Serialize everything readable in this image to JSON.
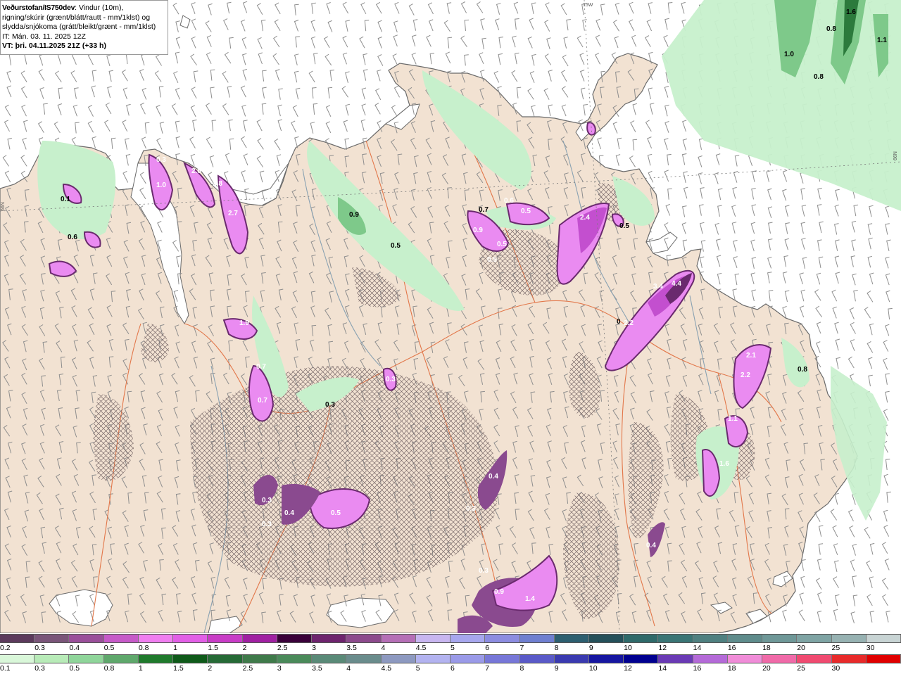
{
  "header": {
    "brand": "Veðurstofan/IS750dev",
    "desc1": ": Vindur (10m),",
    "desc2": "rigning/skúrir (grænt/blátt/rautt - mm/1klst) og",
    "desc3": "slydda/snjókoma (grátt/bleikt/grænt - mm/1klst)",
    "it": "IT: Mán. 03. 11. 2025 12Z",
    "vt": "VT: þri. 04.11.2025 21Z (+33 h)"
  },
  "grid_labels": {
    "top": "15W",
    "left": "66N",
    "right": "66N"
  },
  "colors": {
    "land": "#f2e2d2",
    "sea": "#ffffff",
    "roads": "#e2774a",
    "rivers": "#8aa2b2",
    "wind_barb": "#8e8e8e",
    "snow_dark": "#6a2a6e",
    "snow_mid": "#c34fcf",
    "snow_light": "#ea8bf1",
    "rain_light": "#c7f0cc",
    "rain_mid": "#7ec98a",
    "rain_dark": "#2c7a3c"
  },
  "precip_labels": [
    {
      "t": "0.3",
      "c": "white"
    },
    {
      "t": "1.0",
      "c": "white"
    },
    {
      "t": "2.8",
      "c": "white"
    },
    {
      "t": "2.8",
      "c": "white"
    },
    {
      "t": "2.7",
      "c": "white"
    },
    {
      "t": "1.9",
      "c": "white"
    },
    {
      "t": "0.7",
      "c": "white"
    },
    {
      "t": "0.7",
      "c": "white"
    },
    {
      "t": "0.3",
      "c": "white"
    },
    {
      "t": "0.4",
      "c": "white"
    },
    {
      "t": "0.5",
      "c": "white"
    },
    {
      "t": "0.3",
      "c": "white"
    },
    {
      "t": "0.4",
      "c": "white"
    },
    {
      "t": "0.3",
      "c": "white"
    },
    {
      "t": "0.3",
      "c": "white"
    },
    {
      "t": "0.9",
      "c": "white"
    },
    {
      "t": "1.4",
      "c": "white"
    },
    {
      "t": "0.3",
      "c": "white"
    },
    {
      "t": "0.9",
      "c": "white"
    },
    {
      "t": "0.5",
      "c": "white"
    },
    {
      "t": "0.5",
      "c": "white"
    },
    {
      "t": "2.4",
      "c": "white"
    },
    {
      "t": "0.5",
      "c": "white"
    },
    {
      "t": "0.6",
      "c": "white"
    },
    {
      "t": "3.4",
      "c": "white"
    },
    {
      "t": "4.4",
      "c": "white"
    },
    {
      "t": "2.2",
      "c": "white"
    },
    {
      "t": "2.1",
      "c": "white"
    },
    {
      "t": "2.2",
      "c": "white"
    },
    {
      "t": "1.1",
      "c": "white"
    },
    {
      "t": "1.6",
      "c": "white"
    },
    {
      "t": "0.4",
      "c": "white"
    },
    {
      "t": "0.1",
      "c": "black"
    },
    {
      "t": "0.6",
      "c": "black"
    },
    {
      "t": "0.9",
      "c": "black"
    },
    {
      "t": "0.5",
      "c": "black"
    },
    {
      "t": "0.7",
      "c": "black"
    },
    {
      "t": "0.5",
      "c": "black"
    },
    {
      "t": "0.8",
      "c": "black"
    },
    {
      "t": "1.0",
      "c": "black"
    },
    {
      "t": "0.8",
      "c": "black"
    },
    {
      "t": "0.8",
      "c": "black"
    },
    {
      "t": "1.1",
      "c": "black"
    },
    {
      "t": "1.6",
      "c": "black"
    },
    {
      "t": "0.3",
      "c": "black"
    },
    {
      "t": "0",
      "c": "black"
    }
  ],
  "legend_snow": {
    "ticks": [
      "0.2",
      "0.3",
      "0.4",
      "0.5",
      "0.8",
      "1",
      "1.5",
      "2",
      "2.5",
      "3",
      "3.5",
      "4",
      "4.5",
      "5",
      "6",
      "7",
      "8",
      "9",
      "10",
      "12",
      "14",
      "16",
      "18",
      "20",
      "25",
      "30"
    ],
    "colors": [
      "#5c3a5c",
      "#7a5579",
      "#9a4f9a",
      "#c65ac8",
      "#f07ef0",
      "#e25fe6",
      "#c83cc6",
      "#a020a2",
      "#3a003a",
      "#6e246e",
      "#8c4a8c",
      "#b56fb6",
      "#c8b6f0",
      "#a7a7ee",
      "#8c8ce0",
      "#6f7fd0",
      "#2d5f70",
      "#25505a",
      "#2f6a6a",
      "#3a7575",
      "#4f8080",
      "#5f8c8c",
      "#6f9898",
      "#7fa4a4",
      "#97b2b2",
      "#c8d4d4"
    ]
  },
  "legend_rain": {
    "ticks": [
      "0.1",
      "0.3",
      "0.5",
      "0.8",
      "1",
      "1.5",
      "2",
      "2.5",
      "3",
      "3.5",
      "4",
      "4.5",
      "5",
      "6",
      "7",
      "8",
      "9",
      "10",
      "12",
      "14",
      "16",
      "18",
      "20",
      "25",
      "30"
    ],
    "colors": [
      "#d9f7d9",
      "#b8ebb8",
      "#8fd59a",
      "#5fa86c",
      "#1f7a2c",
      "#0f5a1a",
      "#266a36",
      "#3f7a4a",
      "#4a8a5a",
      "#5a8a78",
      "#6a8c8c",
      "#8d99c0",
      "#b3b3f0",
      "#9a9ae8",
      "#7777d8",
      "#5a5ac8",
      "#3a3ab0",
      "#1616a0",
      "#000090",
      "#6a3ab5",
      "#b46ad8",
      "#f08cd8",
      "#f06aa8",
      "#f04a70",
      "#e82a2a",
      "#e00000"
    ]
  }
}
